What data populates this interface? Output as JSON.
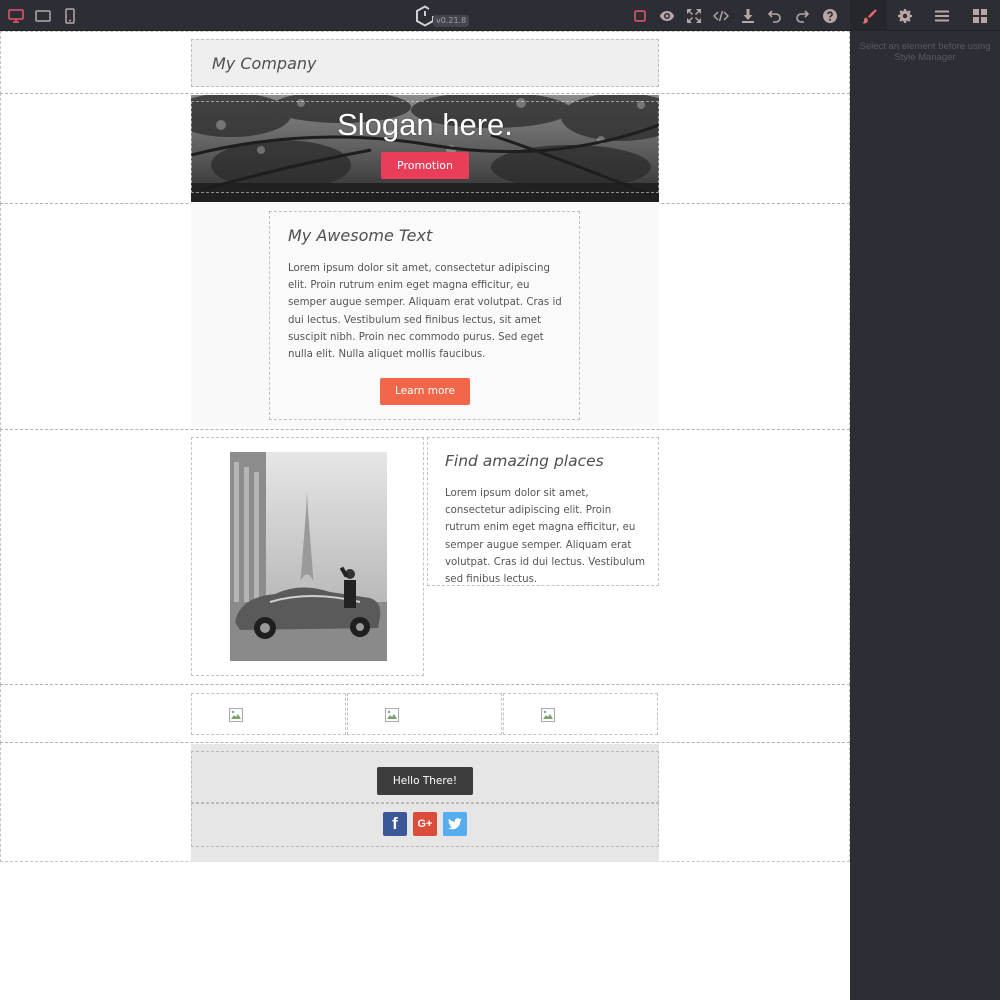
{
  "app": {
    "version": "v0.21.8"
  },
  "toolbar": {
    "devices": [
      {
        "name": "desktop-icon"
      },
      {
        "name": "tablet-icon"
      },
      {
        "name": "mobile-icon"
      }
    ],
    "actions": [
      {
        "name": "sw-visibility-icon"
      },
      {
        "name": "preview-eye-icon"
      },
      {
        "name": "fullscreen-icon"
      },
      {
        "name": "code-icon"
      },
      {
        "name": "download-icon"
      },
      {
        "name": "undo-icon"
      },
      {
        "name": "redo-icon"
      },
      {
        "name": "help-icon"
      }
    ],
    "panels": [
      {
        "name": "style-manager-brush-icon"
      },
      {
        "name": "settings-gear-icon"
      },
      {
        "name": "layers-icon"
      },
      {
        "name": "blocks-grid-icon"
      }
    ]
  },
  "right_panel": {
    "message": "Select an element before using Style Manager"
  },
  "canvas": {
    "header": {
      "company": "My Company"
    },
    "hero": {
      "slogan": "Slogan here.",
      "button": "Promotion"
    },
    "text_card": {
      "title": "My Awesome Text",
      "body": "Lorem ipsum dolor sit amet, consectetur adipiscing elit. Proin rutrum enim eget magna efficitur, eu semper augue semper. Aliquam erat volutpat. Cras id dui lectus. Vestibulum sed finibus lectus, sit amet suscipit nibh. Proin nec commodo purus. Sed eget nulla elit. Nulla aliquet mollis faucibus.",
      "button": "Learn more"
    },
    "places": {
      "title": "Find amazing places",
      "body": "Lorem ipsum dolor sit amet, consectetur adipiscing elit. Proin rutrum enim eget magna efficitur, eu semper augue semper. Aliquam erat volutpat. Cras id dui lectus. Vestibulum sed finibus lectus."
    },
    "footer": {
      "button": "Hello There!",
      "social": [
        {
          "name": "facebook",
          "glyph": "f",
          "color": "#3b5998"
        },
        {
          "name": "google-plus",
          "glyph": "G+",
          "color": "#dd4b39"
        },
        {
          "name": "twitter",
          "glyph": "t",
          "color": "#55acee"
        }
      ]
    }
  },
  "colors": {
    "accent": "#e83e5a",
    "learn_more": "#f2674a",
    "panel_bg": "#2c2e35"
  }
}
